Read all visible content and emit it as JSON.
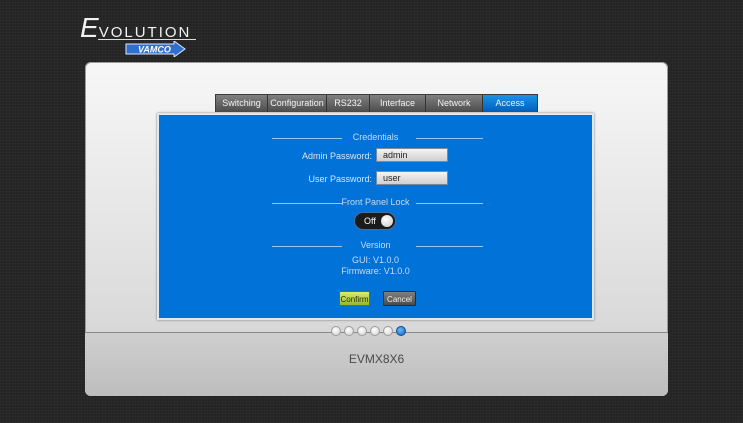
{
  "brand": {
    "initial": "E",
    "rest": "VOLUTION",
    "sub_logo": "VAMCO"
  },
  "tabs": [
    {
      "label": "Switching",
      "active": false
    },
    {
      "label": "Configuration",
      "active": false
    },
    {
      "label": "RS232",
      "active": false
    },
    {
      "label": "Interface",
      "active": false
    },
    {
      "label": "Network",
      "active": false
    },
    {
      "label": "Access",
      "active": true
    }
  ],
  "credentials": {
    "heading": "Credentials",
    "admin_label": "Admin Password:",
    "admin_value": "admin",
    "user_label": "User Password:",
    "user_value": "user"
  },
  "front_panel_lock": {
    "heading": "Front Panel Lock",
    "state": "Off"
  },
  "version": {
    "heading": "Version",
    "gui": "GUI: V1.0.0",
    "firmware": "Firmware: V1.0.0"
  },
  "buttons": {
    "confirm": "Confirm",
    "cancel": "Cancel"
  },
  "pager": {
    "count": 6,
    "active_index": 5
  },
  "model": "EVMX8X6",
  "colors": {
    "panel_blue": "#0072d8",
    "active_tab": "#0a7fd9",
    "confirm": "#b7d43f"
  }
}
